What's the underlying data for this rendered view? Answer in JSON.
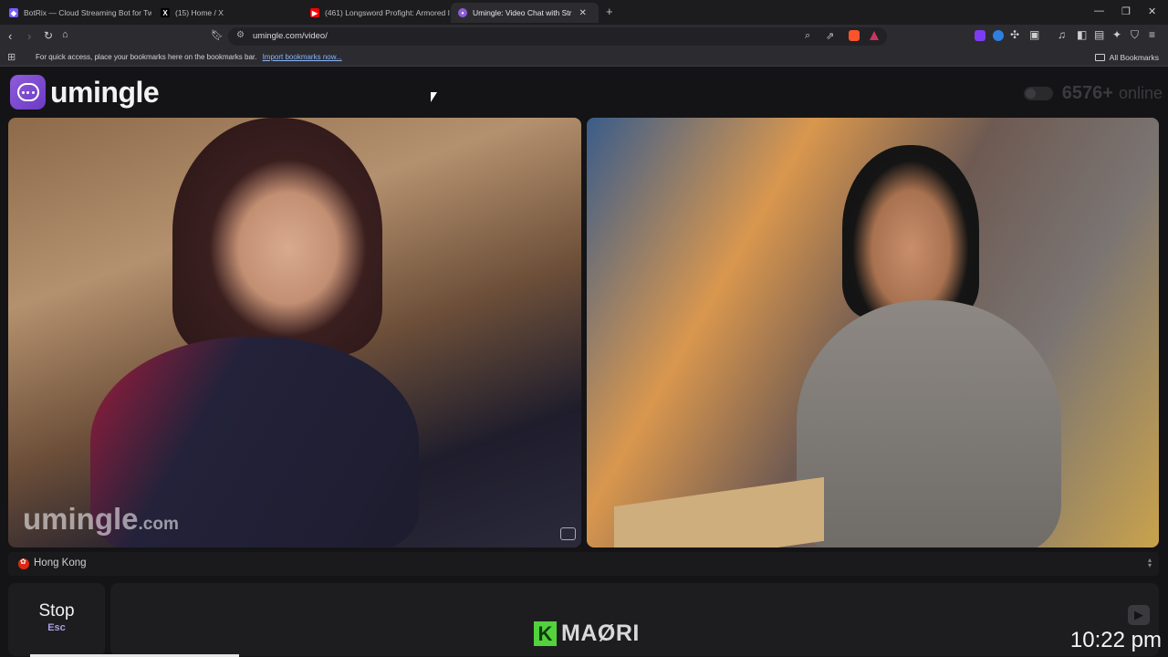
{
  "browser": {
    "tabs": [
      {
        "title": "BotRix — Cloud Streaming Bot for Tw",
        "favicon": "botrix-icon",
        "color": "#7c5cff"
      },
      {
        "title": "(15) Home / X",
        "favicon": "x-icon",
        "color": "#000000"
      },
      {
        "title": "(461) Longsword Profight: Armored I",
        "favicon": "youtube-icon",
        "color": "#ff0000"
      },
      {
        "title": "Umingle: Video Chat with Str",
        "favicon": "umingle-icon",
        "color": "#8e5bd9",
        "active": true
      }
    ],
    "new_tab": "+",
    "url": "umingle.com/video/",
    "bookmarks_message": "For quick access, place your bookmarks here on the bookmarks bar.",
    "import_link": "Import bookmarks now...",
    "all_bookmarks": "All Bookmarks"
  },
  "site": {
    "logo_text": "umingle",
    "online_count": "6576+",
    "online_label": "online",
    "watermark_main": "umingle",
    "watermark_suffix": ".com",
    "location": "Hong Kong",
    "stop_label": "Stop",
    "stop_key": "Esc"
  },
  "overlay": {
    "brand": "MAØRI",
    "brand_icon": "K",
    "clock": "10:22 pm"
  },
  "colors": {
    "accent": "#8e5bd9",
    "kick_green": "#53d23d"
  }
}
